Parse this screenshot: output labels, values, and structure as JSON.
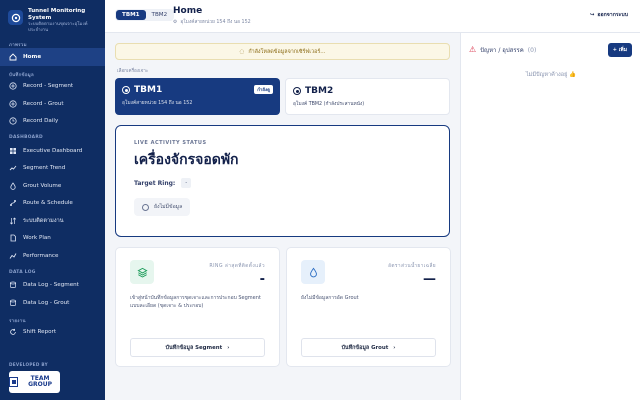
{
  "brand": {
    "title": "Tunnel Monitoring System",
    "subtitle": "ระบบติดตามงานขุดเจาะอุโมงค์ ประจำงาน"
  },
  "sidebar": {
    "sections": [
      {
        "label": "ภาพรวม"
      },
      {
        "label": "บันทึกข้อมูล"
      },
      {
        "label": "DASHBOARD"
      },
      {
        "label": "DATA LOG"
      },
      {
        "label": "รายงาน"
      }
    ],
    "items": {
      "home": "Home",
      "record_segment": "Record - Segment",
      "record_grout": "Record - Grout",
      "record_daily": "Record Daily",
      "executive_dashboard": "Executive Dashboard",
      "segment_trend": "Segment Trend",
      "grout_volume": "Grout Volume",
      "route_schedule": "Route & Schedule",
      "ring_progress": "ระบบติดตามงาน",
      "work_plan": "Work Plan",
      "performance": "Performance",
      "datalog_segment": "Data Log - Segment",
      "datalog_grout": "Data Log - Grout",
      "shift_report": "Shift Report"
    },
    "developed_by": "DEVELOPED BY",
    "dev_logo": "TEAM GROUP"
  },
  "header": {
    "tbm_options": [
      "TBM1",
      "TBM2"
    ],
    "title": "Home",
    "subtitle": "อุโมงค์สายหน่วย 154 ถึง นอ 152",
    "logout": "ออกจากระบบ"
  },
  "main": {
    "banner": "กำลังโหลดข้อมูลจากเซิร์ฟเวอร์...",
    "select_label": "เลือกเครื่องเจาะ",
    "machines": [
      {
        "name": "TBM1",
        "desc": "อุโมงค์สายหน่วย 154 ถึง นอ 152",
        "badge": "กำลังดู"
      },
      {
        "name": "TBM2",
        "desc": "อุโมงค์ TBM2 (กำลังประสานหนัง)"
      }
    ],
    "live": {
      "label": "LIVE ACTIVITY STATUS",
      "status": "เครื่องจักรจอดพัก",
      "target_label": "Target Ring:",
      "target_value": "-",
      "nodata": "ยังไม่มีข้อมูล"
    },
    "stats": [
      {
        "label": "RING ล่าสุดที่ติดตั้งแล้ว",
        "value": "-",
        "desc": "เข้าสู่หน้าบันทึกข้อมูลการขุดเจาะและการประกอบ Segment แบบละเอียด (ขุดเจาะ & ประกอบ)",
        "button": "บันทึกข้อมูล Segment"
      },
      {
        "label": "อัตราส่วนน้ำยาเฉลี่ย",
        "value": "—",
        "desc": "ยังไม่มีข้อมูลการอัด Grout",
        "button": "บันทึกข้อมูล Grout"
      }
    ]
  },
  "issues": {
    "title": "ปัญหา / อุปสรรค",
    "count": "(0)",
    "add": "+ เพิ่ม",
    "empty": "ไม่มีปัญหาค้างอยู่ 👍"
  },
  "colors": {
    "sidebar": "#0f2d63",
    "accent": "#173a80",
    "banner_bg": "#fbf7e6",
    "warning": "#d9334a"
  }
}
